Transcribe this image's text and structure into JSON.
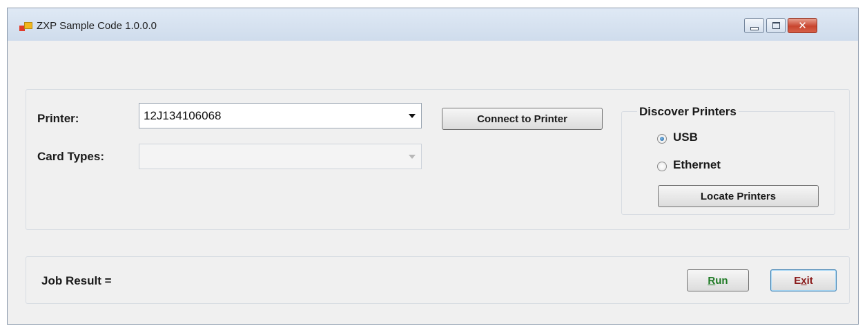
{
  "window": {
    "title": "ZXP Sample Code 1.0.0.0",
    "controls": {
      "minimize": "minimize",
      "maximize": "maximize",
      "close": "close"
    }
  },
  "form": {
    "printer_label": "Printer:",
    "printer_value": "12J134106068",
    "card_types_label": "Card Types:",
    "card_types_value": "",
    "connect_button": "Connect to Printer"
  },
  "discover": {
    "title": "Discover Printers",
    "options": [
      {
        "label": "USB",
        "selected": true
      },
      {
        "label": "Ethernet",
        "selected": false
      }
    ],
    "locate_button": "Locate Printers"
  },
  "job": {
    "result_label": "Job Result =",
    "run_button": "Run",
    "run_accel": "R",
    "run_rest": "un",
    "exit_button": "Exit",
    "exit_first": "E",
    "exit_accel": "x",
    "exit_rest": "it"
  },
  "icons": [
    "app-icon",
    "minimize-icon",
    "maximize-icon",
    "close-icon",
    "dropdown-arrow-icon"
  ],
  "colors": {
    "titlebar": "#d6e2f0",
    "close_button": "#c8452f",
    "run_accent": "#1e7a24",
    "exit_accent": "#8b1c1c"
  }
}
